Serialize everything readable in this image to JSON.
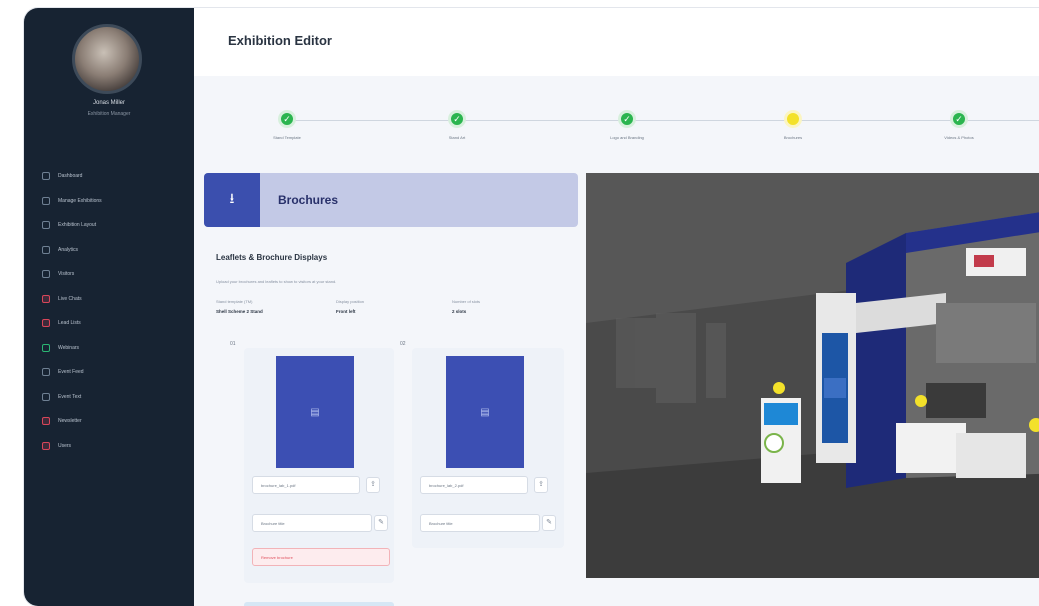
{
  "sidebar": {
    "user_name": "Jonas Miller",
    "user_role": "Exhibition Manager",
    "items": [
      {
        "label": "Dashboard"
      },
      {
        "label": "Manage Exhibitions"
      },
      {
        "label": "Exhibition Layout"
      },
      {
        "label": "Analytics"
      },
      {
        "label": "Visitors"
      },
      {
        "label": "Live Chats"
      },
      {
        "label": "Lead Lists"
      },
      {
        "label": "Webinars"
      },
      {
        "label": "Event Feed"
      },
      {
        "label": "Event Text"
      },
      {
        "label": "Newsletter"
      },
      {
        "label": "Users"
      }
    ]
  },
  "header": {
    "title": "Exhibition Editor"
  },
  "stepper": {
    "steps": [
      {
        "label": "Stand Template",
        "state": "done"
      },
      {
        "label": "Stand Art",
        "state": "done"
      },
      {
        "label": "Logo and Branding",
        "state": "done"
      },
      {
        "label": "Brochures",
        "state": "current"
      },
      {
        "label": "Videos & Photos",
        "state": "done"
      }
    ]
  },
  "section": {
    "icon": "download-icon",
    "title": "Brochures",
    "subtitle": "Leaflets & Brochure Displays",
    "description": "Upload your brochures and leaflets to show to visitors at your stand.",
    "meta": [
      {
        "label": "Stand template (TM)",
        "value": "Shell Scheme 2 Stand"
      },
      {
        "label": "Display position",
        "value": "Front left"
      },
      {
        "label": "Number of slots",
        "value": "2 slots"
      }
    ]
  },
  "cards": [
    {
      "index": "01",
      "filename": "brochure_lab_1.pdf",
      "title_field": "Brochure title",
      "remove_label": "Remove brochure"
    },
    {
      "index": "02",
      "filename": "brochure_lab_2.pdf",
      "title_field": "Brochure title"
    }
  ],
  "colors": {
    "sidebar_bg": "#172332",
    "accent_blue": "#3b4fae",
    "step_done": "#2bb54f",
    "step_current": "#f3e12a"
  }
}
